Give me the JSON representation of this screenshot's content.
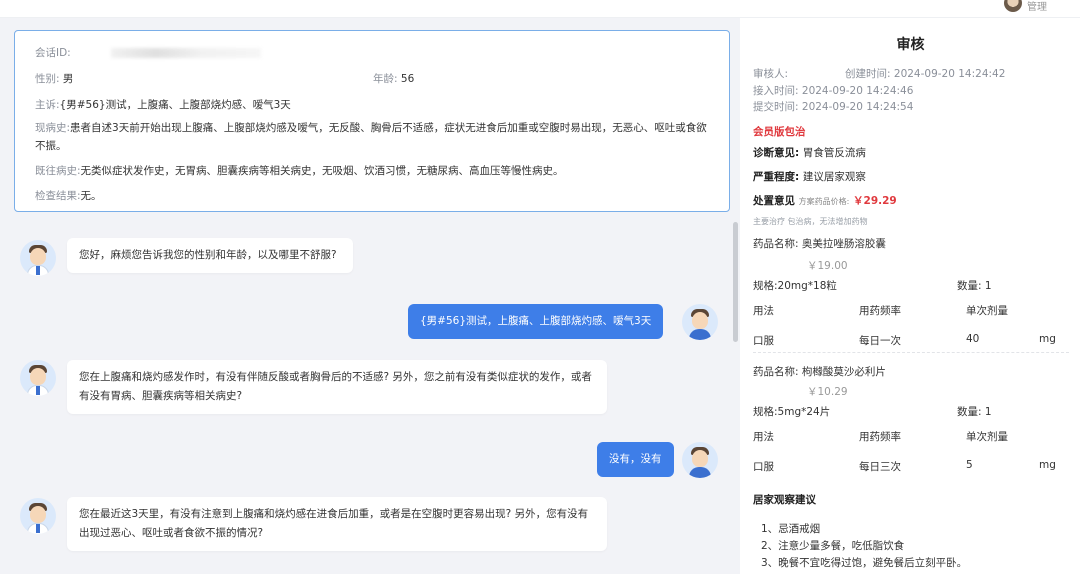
{
  "topbar": {
    "username": "管理"
  },
  "patient": {
    "session_id_label": "会话ID:",
    "gender_label": "性别:",
    "gender": "男",
    "age_label": "年龄:",
    "age": "56",
    "complaint_label": "主诉:",
    "complaint": "{男#56}测试，上腹痛、上腹部烧灼感、嗳气3天",
    "present_history_label": "现病史:",
    "present_history": "患者自述3天前开始出现上腹痛、上腹部烧灼感及嗳气，无反酸、胸骨后不适感，症状无进食后加重或空腹时易出现，无恶心、呕吐或食欲不振。",
    "past_history_label": "既往病史:",
    "past_history": "无类似症状发作史，无胃病、胆囊疾病等相关病史，无吸烟、饮酒习惯，无糖尿病、高血压等慢性病史。",
    "exam_label": "检查结果:",
    "exam": "无。"
  },
  "chat": [
    {
      "from": "doctor",
      "text": "您好，麻烦您告诉我您的性别和年龄，以及哪里不舒服?"
    },
    {
      "from": "patient",
      "text": "{男#56}测试，上腹痛、上腹部烧灼感、嗳气3天"
    },
    {
      "from": "doctor",
      "text": "您在上腹痛和烧灼感发作时，有没有伴随反酸或者胸骨后的不适感? 另外，您之前有没有类似症状的发作，或者有没有胃病、胆囊疾病等相关病史?"
    },
    {
      "from": "patient",
      "text": "没有，没有"
    },
    {
      "from": "doctor",
      "text": "您在最近这3天里，有没有注意到上腹痛和烧灼感在进食后加重，或者是在空腹时更容易出现? 另外，您有没有出现过恶心、呕吐或者食欲不振的情况?"
    }
  ],
  "review": {
    "title": "审核",
    "reviewer_label": "审核人:",
    "created_label": "创建时间:",
    "created": "2024-09-20 14:24:42",
    "accepted_label": "接入时间:",
    "accepted": "2024-09-20 14:24:46",
    "submitted_label": "提交时间:",
    "submitted": "2024-09-20 14:24:54",
    "package": "会员版包治",
    "diagnosis_label": "诊断意见:",
    "diagnosis": "胃食管反流病",
    "severity_label": "严重程度:",
    "severity": "建议居家观察",
    "treatment_label": "处置意见",
    "price_label": "方案药品价格:",
    "price": "￥29.29",
    "main_treatment": "主要治疗",
    "main_treatment_note": "包治病，无法增加药物",
    "drug_name_label": "药品名称:",
    "spec_label": "规格:",
    "qty_label": "数量:",
    "col_usage": "用法",
    "col_freq": "用药频率",
    "col_dose": "单次剂量",
    "drugs": [
      {
        "name": "奥美拉唑肠溶胶囊",
        "price": "￥19.00",
        "spec": "20mg*18粒",
        "qty": "1",
        "usage": "口服",
        "freq": "每日一次",
        "dose": "40",
        "unit": "mg"
      },
      {
        "name": "枸橼酸莫沙必利片",
        "price": "￥10.29",
        "spec": "5mg*24片",
        "qty": "1",
        "usage": "口服",
        "freq": "每日三次",
        "dose": "5",
        "unit": "mg"
      }
    ],
    "advice_title": "居家观察建议",
    "advice": [
      "1、忌酒戒烟",
      "2、注意少量多餐，吃低脂饮食",
      "3、晚餐不宜吃得过饱，避免餐后立刻平卧。"
    ]
  }
}
